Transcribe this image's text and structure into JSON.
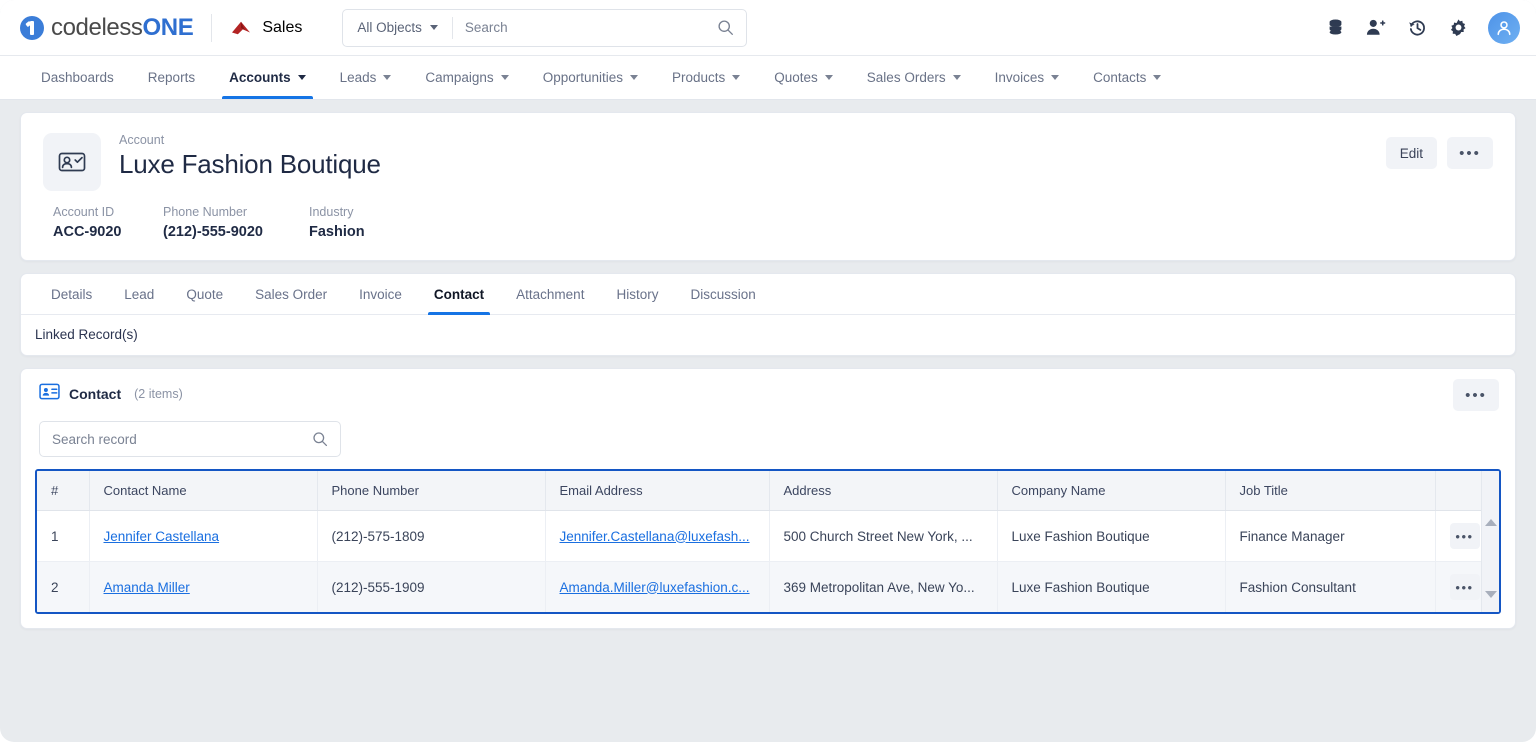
{
  "brand": {
    "part1": "codeless",
    "part2": "ONE"
  },
  "app_switcher": {
    "label": "Sales",
    "icon": "sales-triangle-icon"
  },
  "global_search": {
    "object_filter": "All Objects",
    "placeholder": "Search",
    "value": "",
    "icon": "search-icon"
  },
  "top_icons": [
    {
      "name": "database-icon"
    },
    {
      "name": "add-user-icon"
    },
    {
      "name": "history-icon"
    },
    {
      "name": "gear-icon"
    },
    {
      "name": "user-avatar-icon"
    }
  ],
  "nav": {
    "items": [
      {
        "label": "Dashboards",
        "caret": false,
        "active": false
      },
      {
        "label": "Reports",
        "caret": false,
        "active": false
      },
      {
        "label": "Accounts",
        "caret": true,
        "active": true
      },
      {
        "label": "Leads",
        "caret": true,
        "active": false
      },
      {
        "label": "Campaigns",
        "caret": true,
        "active": false
      },
      {
        "label": "Opportunities",
        "caret": true,
        "active": false
      },
      {
        "label": "Products",
        "caret": true,
        "active": false
      },
      {
        "label": "Quotes",
        "caret": true,
        "active": false
      },
      {
        "label": "Sales Orders",
        "caret": true,
        "active": false
      },
      {
        "label": "Invoices",
        "caret": true,
        "active": false
      },
      {
        "label": "Contacts",
        "caret": true,
        "active": false
      }
    ]
  },
  "record": {
    "kicker": "Account",
    "title": "Luxe Fashion Boutique",
    "icon": "account-card-icon",
    "edit_label": "Edit",
    "more_label": "•••",
    "fields": [
      {
        "label": "Account ID",
        "value": "ACC-9020"
      },
      {
        "label": "Phone Number",
        "value": "(212)-555-9020"
      },
      {
        "label": "Industry",
        "value": "Fashion"
      }
    ]
  },
  "tabs": [
    {
      "label": "Details",
      "active": false
    },
    {
      "label": "Lead",
      "active": false
    },
    {
      "label": "Quote",
      "active": false
    },
    {
      "label": "Sales Order",
      "active": false
    },
    {
      "label": "Invoice",
      "active": false
    },
    {
      "label": "Contact",
      "active": true
    },
    {
      "label": "Attachment",
      "active": false
    },
    {
      "label": "History",
      "active": false
    },
    {
      "label": "Discussion",
      "active": false
    }
  ],
  "linked_records_label": "Linked Record(s)",
  "panel": {
    "icon": "contact-card-icon",
    "title": "Contact",
    "count": "(2 items)",
    "more_label": "•••",
    "search_placeholder": "Search record",
    "search_value": "",
    "search_icon": "search-icon"
  },
  "table": {
    "columns": [
      "#",
      "Contact Name",
      "Phone Number",
      "Email Address",
      "Address",
      "Company Name",
      "Job Title"
    ],
    "row_action_label": "•••",
    "rows": [
      {
        "num": "1",
        "name": "Jennifer Castellana",
        "phone": "(212)-575-1809",
        "email": "Jennifer.Castellana@luxefash...",
        "address": "500 Church Street New York, ...",
        "company": "Luxe Fashion Boutique",
        "job": "Finance Manager"
      },
      {
        "num": "2",
        "name": "Amanda Miller",
        "phone": "(212)-555-1909",
        "email": "Amanda.Miller@luxefashion.c...",
        "address": "369 Metropolitan Ave, New Yo...",
        "company": "Luxe Fashion Boutique",
        "job": "Fashion Consultant"
      }
    ]
  },
  "colors": {
    "accent_blue": "#1574e5",
    "link_blue": "#1a6fe0",
    "selection_border": "#1456c4",
    "brand_blue": "#2f6fd0",
    "sales_red": "#b32424",
    "page_bg": "#e8ebee"
  }
}
